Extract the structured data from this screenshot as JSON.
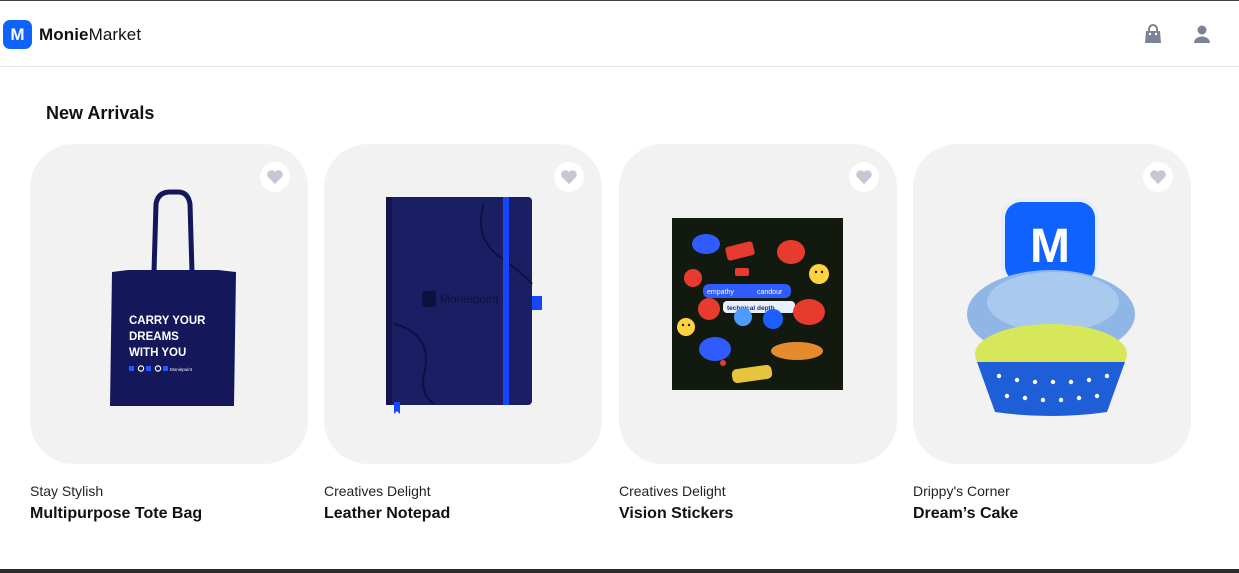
{
  "header": {
    "logo_letter": "M",
    "brand_bold": "Monie",
    "brand_regular": "Market",
    "icons": [
      "shopping-bag-icon",
      "user-icon"
    ]
  },
  "section": {
    "title": "New Arrivals"
  },
  "products": [
    {
      "category": "Stay Stylish",
      "name": "Multipurpose Tote Bag",
      "art": {
        "line1": "CARRY YOUR",
        "line2": "DREAMS",
        "line3": "WITH YOU",
        "brand": "Moniepoint"
      }
    },
    {
      "category": "Creatives Delight",
      "name": "Leather Notepad",
      "art": {
        "brand": "Moniepoint"
      }
    },
    {
      "category": "Creatives Delight",
      "name": "Vision Stickers",
      "art": {
        "s1": "empathy",
        "s2": "candour",
        "s3": "technical depth"
      }
    },
    {
      "category": "Drippy's Corner",
      "name": "Dream’s Cake",
      "art": {
        "topper": "M"
      }
    }
  ],
  "colors": {
    "accent": "#0f62fe",
    "card_bg": "#f2f2f3",
    "navy": "#14185a",
    "icon_gray": "#7d8296"
  }
}
